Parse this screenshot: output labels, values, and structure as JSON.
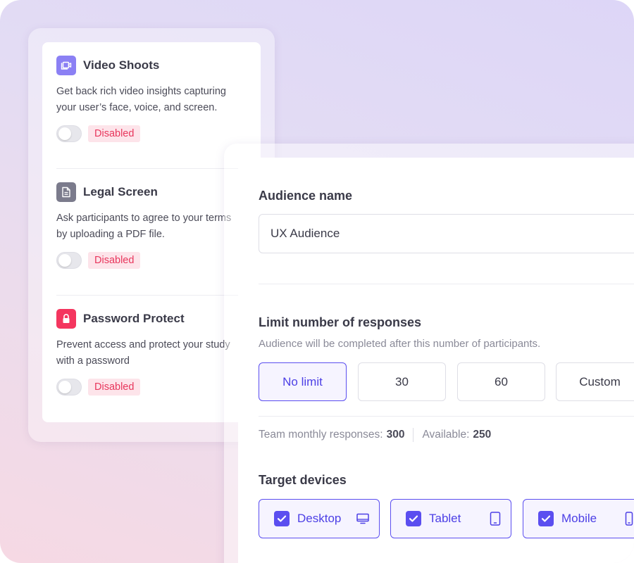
{
  "features": [
    {
      "title": "Video Shoots",
      "description": "Get back rich video insights capturing your user’s face, voice, and screen.",
      "status": "Disabled",
      "icon": "video-icon",
      "icon_color": "#8b80f4"
    },
    {
      "title": "Legal Screen",
      "description": "Ask participants to agree to your terms by uploading a PDF file.",
      "status": "Disabled",
      "icon": "document-icon",
      "icon_color": "#7b7b8c"
    },
    {
      "title": "Password Protect",
      "description": "Prevent access and protect your study with a password",
      "status": "Disabled",
      "icon": "lock-icon",
      "icon_color": "#f4365f"
    }
  ],
  "audience": {
    "name_label": "Audience name",
    "name_value": "UX Audience"
  },
  "limit": {
    "title": "Limit number of responses",
    "subtitle": "Audience will be completed after this number of participants.",
    "options": [
      "No limit",
      "30",
      "60",
      "Custom"
    ],
    "selected": "No limit"
  },
  "meta": {
    "monthly_label": "Team monthly responses:",
    "monthly_value": "300",
    "available_label": "Available:",
    "available_value": "250"
  },
  "devices": {
    "title": "Target devices",
    "items": [
      {
        "label": "Desktop",
        "icon": "desktop-icon",
        "checked": true
      },
      {
        "label": "Tablet",
        "icon": "tablet-icon",
        "checked": true
      },
      {
        "label": "Mobile",
        "icon": "mobile-icon",
        "checked": true
      }
    ]
  },
  "colors": {
    "accent": "#5b4ef0",
    "disabled_text": "#e8365c",
    "disabled_bg": "#fde4ea"
  }
}
